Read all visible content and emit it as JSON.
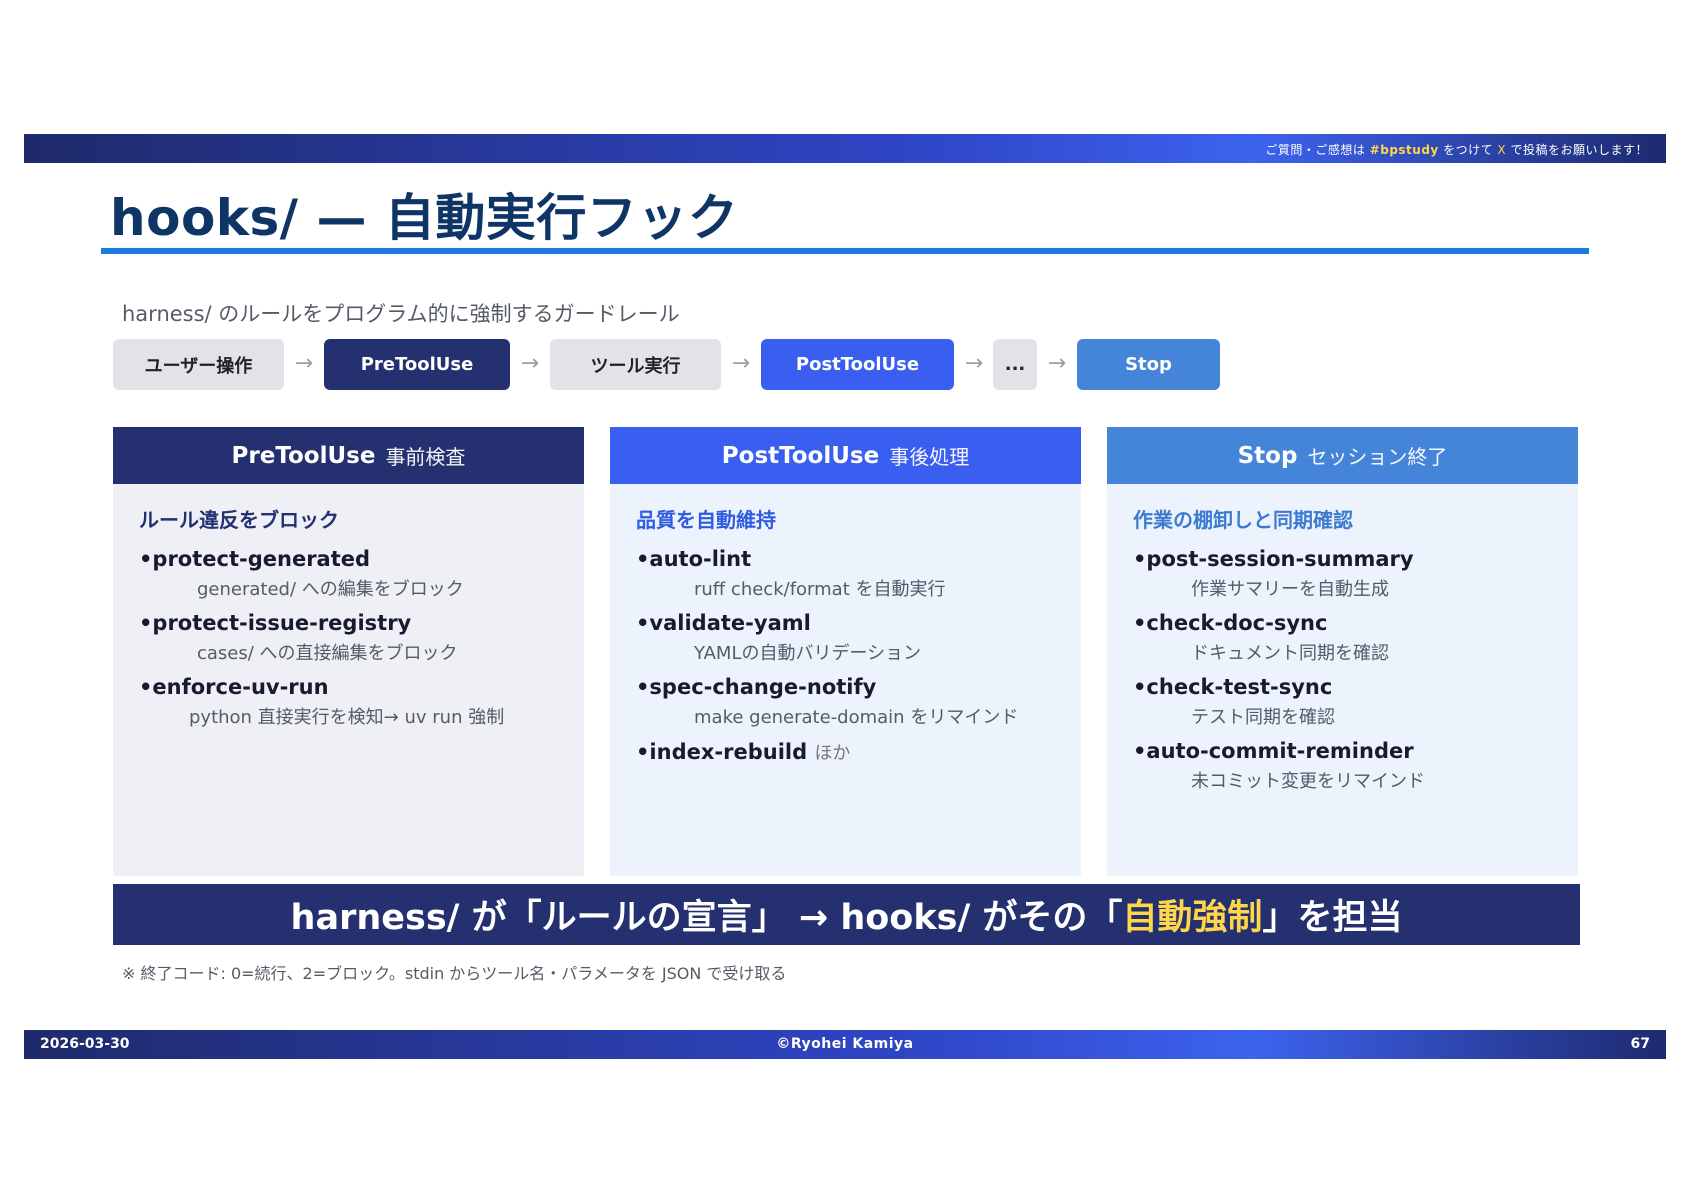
{
  "header": {
    "message_pre": "ご質問・ご感想は",
    "hashtag": "#bpstudy",
    "message_mid": "をつけて",
    "platform": "X",
    "message_post": "で投稿をお願いします！"
  },
  "title": "hooks/ — 自動実行フック",
  "subtitle": "harness/ のルールをプログラム的に強制するガードレール",
  "flow": {
    "steps": [
      "ユーザー操作",
      "PreToolUse",
      "ツール実行",
      "PostToolUse",
      "...",
      "Stop"
    ],
    "arrow": "→"
  },
  "panels": [
    {
      "name": "PreToolUse",
      "subtitle": "事前検査",
      "section": "ルール違反をブロック",
      "items": [
        {
          "name": "•protect-generated",
          "desc": "generated/ への編集をブロック"
        },
        {
          "name": "•protect-issue-registry",
          "desc": "cases/ への直接編集をブロック"
        },
        {
          "name": "•enforce-uv-run",
          "desc": "python 直接実行を検知→ uv run 強制"
        }
      ]
    },
    {
      "name": "PostToolUse",
      "subtitle": "事後処理",
      "section": "品質を自動維持",
      "items": [
        {
          "name": "•auto-lint",
          "desc": "ruff check/format を自動実行"
        },
        {
          "name": "•validate-yaml",
          "desc": "YAMLの自動バリデーション"
        },
        {
          "name": "•spec-change-notify",
          "desc": "make generate-domain をリマインド"
        },
        {
          "name": "•index-rebuild",
          "note": "ほか"
        }
      ]
    },
    {
      "name": "Stop",
      "subtitle": "セッション終了",
      "section": "作業の棚卸しと同期確認",
      "items": [
        {
          "name": "•post-session-summary",
          "desc": "作業サマリーを自動生成"
        },
        {
          "name": "•check-doc-sync",
          "desc": "ドキュメント同期を確認"
        },
        {
          "name": "•check-test-sync",
          "desc": "テスト同期を確認"
        },
        {
          "name": "•auto-commit-reminder",
          "desc": "未コミット変更をリマインド"
        }
      ]
    }
  ],
  "banner": {
    "pre": "harness/ が「ルールの宣言」 → hooks/ がその「",
    "highlight": "自動強制",
    "post": "」を担当"
  },
  "note": "※ 終了コード: 0=続行、2=ブロック。stdin からツール名・パラメータを JSON で受け取る",
  "footer": {
    "date": "2026-03-30",
    "copyright": "©Ryohei Kamiya",
    "page": "67"
  },
  "colors": {
    "navy": "#24306f",
    "blue": "#3a5ef0",
    "sky": "#4485d9",
    "title": "#0e3566",
    "accent_rule": "#1f7ae0",
    "highlight": "#ffd54a"
  }
}
